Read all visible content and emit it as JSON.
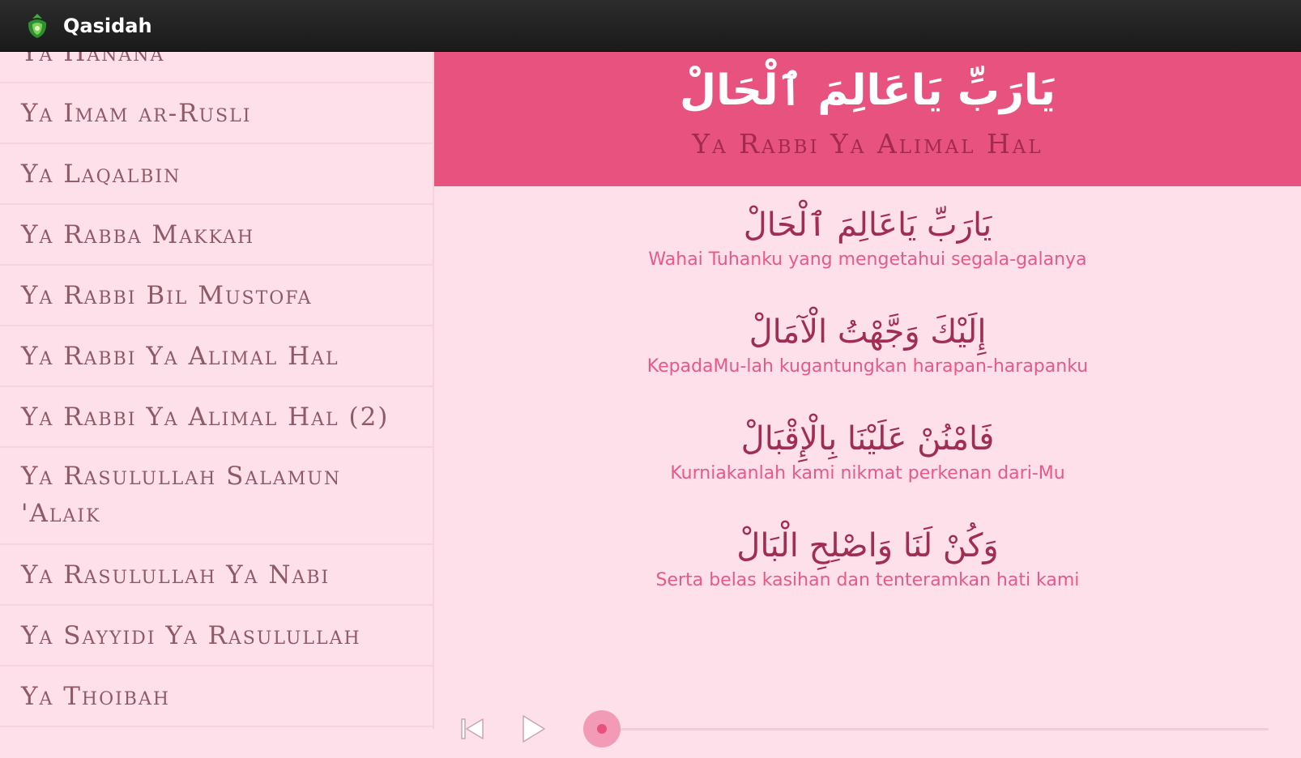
{
  "app": {
    "title": "Qasidah",
    "icon": "app-logo-icon"
  },
  "sidebar": {
    "items": [
      {
        "label": "Ya Hanana"
      },
      {
        "label": "Ya Imam ar-Rusli"
      },
      {
        "label": "Ya Laqalbin"
      },
      {
        "label": "Ya Rabba Makkah"
      },
      {
        "label": "Ya Rabbi Bil Mustofa"
      },
      {
        "label": "Ya Rabbi Ya Alimal Hal"
      },
      {
        "label": "Ya Rabbi Ya Alimal Hal (2)"
      },
      {
        "label": "Ya Rasulullah Salamun 'Alaik"
      },
      {
        "label": "Ya Rasulullah Ya Nabi"
      },
      {
        "label": "Ya Sayyidi Ya Rasulullah"
      },
      {
        "label": "Ya Thoibah"
      }
    ]
  },
  "header": {
    "arabic": "يَارَبِّ يَاعَالِمَ ٱلْحَالْ",
    "title": "Ya Rabbi Ya Alimal Hal"
  },
  "verses": [
    {
      "arabic": "يَارَبِّ يَاعَالِمَ ٱلْحَالْ",
      "translation": "Wahai Tuhanku yang mengetahui segala-galanya"
    },
    {
      "arabic": "إِلَيْكَ وَجَّهْتُ الْآمَالْ",
      "translation": "KepadaMu-lah kugantungkan harapan-harapanku"
    },
    {
      "arabic": "فَامْنُنْ عَلَيْنَا بِالْإِقْبَالْ",
      "translation": "Kurniakanlah kami nikmat perkenan dari-Mu"
    },
    {
      "arabic": "وَكُنْ لَنَا وَاصْلِحِ الْبَالْ",
      "translation": "Serta belas kasihan dan tenteramkan hati kami"
    }
  ],
  "player": {
    "prev_icon": "skip-previous-icon",
    "play_icon": "play-icon",
    "progress": 0.02
  },
  "colors": {
    "accent": "#e8527f",
    "background": "#fde0ea",
    "actionbar": "#1f1f1f"
  }
}
